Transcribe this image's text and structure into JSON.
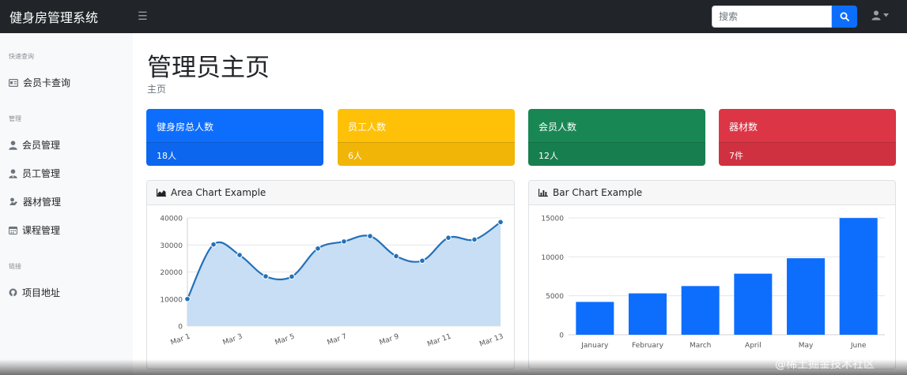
{
  "nav": {
    "brand": "健身房管理系统",
    "toggle_icon": "☰",
    "search_placeholder": "搜索"
  },
  "sidebar": {
    "sections": [
      {
        "heading": "快速查询",
        "items": [
          {
            "label": "会员卡查询",
            "icon": "id-card-icon"
          }
        ]
      },
      {
        "heading": "管理",
        "items": [
          {
            "label": "会员管理",
            "icon": "user-icon"
          },
          {
            "label": "员工管理",
            "icon": "user-tie-icon"
          },
          {
            "label": "器材管理",
            "icon": "dumbbell-icon"
          },
          {
            "label": "课程管理",
            "icon": "calendar-icon"
          }
        ]
      },
      {
        "heading": "链接",
        "items": [
          {
            "label": "项目地址",
            "icon": "github-icon"
          }
        ]
      }
    ]
  },
  "main": {
    "title": "管理员主页",
    "breadcrumb": "主页"
  },
  "cards": [
    {
      "title": "健身房总人数",
      "value": "18人",
      "color": "#0d6efd"
    },
    {
      "title": "员工人数",
      "value": "6人",
      "color": "#ffc107"
    },
    {
      "title": "会员人数",
      "value": "12人",
      "color": "#198754"
    },
    {
      "title": "器材数",
      "value": "7件",
      "color": "#dc3545"
    }
  ],
  "panels": {
    "area_title": "Area Chart Example",
    "bar_title": "Bar Chart Example"
  },
  "chart_data": [
    {
      "type": "area",
      "x": [
        "Mar 1",
        "Mar 2",
        "Mar 3",
        "Mar 4",
        "Mar 5",
        "Mar 6",
        "Mar 7",
        "Mar 8",
        "Mar 9",
        "Mar 10",
        "Mar 11",
        "Mar 12",
        "Mar 13"
      ],
      "tick_labels": [
        "Mar 1",
        "Mar 3",
        "Mar 5",
        "Mar 7",
        "Mar 9",
        "Mar 11",
        "Mar 13"
      ],
      "values": [
        10000,
        30162,
        26263,
        18394,
        18287,
        28682,
        31274,
        33259,
        25849,
        24159,
        32651,
        31984,
        38451
      ],
      "ylim": [
        0,
        40000
      ],
      "yticks": [
        0,
        10000,
        20000,
        30000,
        40000
      ],
      "line_color": "#2470b8",
      "fill_color": "#c7def4",
      "grid": true
    },
    {
      "type": "bar",
      "categories": [
        "January",
        "February",
        "March",
        "April",
        "May",
        "June"
      ],
      "values": [
        4215,
        5312,
        6251,
        7841,
        9821,
        14984
      ],
      "ylim": [
        0,
        15000
      ],
      "yticks": [
        0,
        5000,
        10000,
        15000
      ],
      "bar_color": "#0d6efd",
      "grid": true
    }
  ],
  "watermark": "@稀土掘金技术社区"
}
